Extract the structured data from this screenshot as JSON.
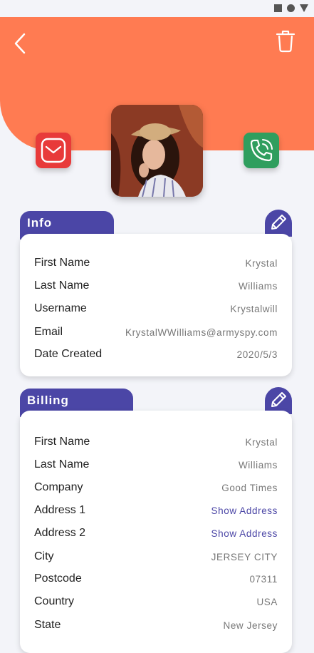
{
  "colors": {
    "accent": "#ff7b52",
    "primary": "#4b46a6",
    "mail": "#e83a3a",
    "phone": "#2f9e5e"
  },
  "icons": {
    "back": "chevron-left-icon",
    "delete": "trash-icon",
    "mail": "mail-icon",
    "phone": "phone-icon",
    "edit": "pencil-icon",
    "status": [
      "square-icon",
      "circle-icon",
      "triangle-icon"
    ]
  },
  "info": {
    "title": "Info",
    "rows": [
      {
        "label": "First Name",
        "value": "Krystal"
      },
      {
        "label": "Last Name",
        "value": "Williams"
      },
      {
        "label": "Username",
        "value": "Krystalwill"
      },
      {
        "label": "Email",
        "value": "KrystalWWilliams@armyspy.com"
      },
      {
        "label": "Date Created",
        "value": "2020/5/3"
      }
    ]
  },
  "billing": {
    "title": "Billing",
    "rows": [
      {
        "label": "First Name",
        "value": "Krystal"
      },
      {
        "label": "Last Name",
        "value": "Williams"
      },
      {
        "label": "Company",
        "value": "Good Times"
      },
      {
        "label": "Address 1",
        "value": "Show Address"
      },
      {
        "label": "Address 2",
        "value": "Show Address"
      },
      {
        "label": "City",
        "value": "JERSEY CITY"
      },
      {
        "label": "Postcode",
        "value": "07311"
      },
      {
        "label": "Country",
        "value": "USA"
      },
      {
        "label": "State",
        "value": "New Jersey"
      }
    ]
  }
}
